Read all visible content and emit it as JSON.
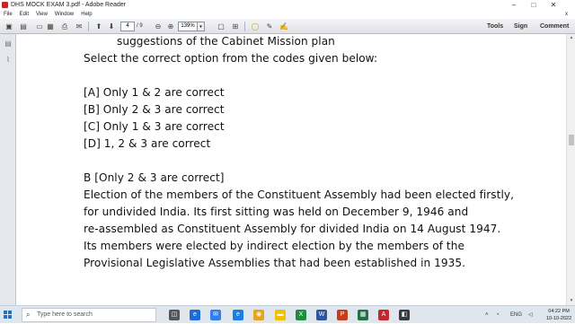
{
  "window": {
    "title": "DHS MOCK EXAM 3.pdf - Adobe Reader",
    "minimize": "–",
    "maximize": "□",
    "close": "✕"
  },
  "menu": {
    "items": [
      "File",
      "Edit",
      "View",
      "Window",
      "Help"
    ],
    "close": "x"
  },
  "toolbar": {
    "page_current": "4",
    "page_total": "/ 9",
    "zoom": "139%",
    "tools_label": "Tools",
    "sign_label": "Sign",
    "comment_label": "Comment"
  },
  "document": {
    "lines": [
      "suggestions of the Cabinet Mission plan",
      "Select the correct option from the codes given below:",
      "[A] Only 1 & 2 are correct",
      "[B] Only 2 & 3 are correct",
      "[C] Only 1 & 3 are correct",
      "[D] 1, 2 & 3 are correct",
      "B [Only 2 & 3 are correct]",
      "Election of the members of the Constituent Assembly had been elected firstly,",
      "for undivided India. Its first sitting was held on December 9, 1946 and",
      "re-assembled as Constituent Assembly for divided India on 14 August 1947.",
      "Its members were elected by indirect election by the members of the",
      "Provisional Legislative Assemblies that had been established in 1935."
    ]
  },
  "taskbar": {
    "search_placeholder": "Type here to search",
    "tray_lang": "ENG",
    "time": "04:22 PM",
    "date": "10-10-2022"
  }
}
